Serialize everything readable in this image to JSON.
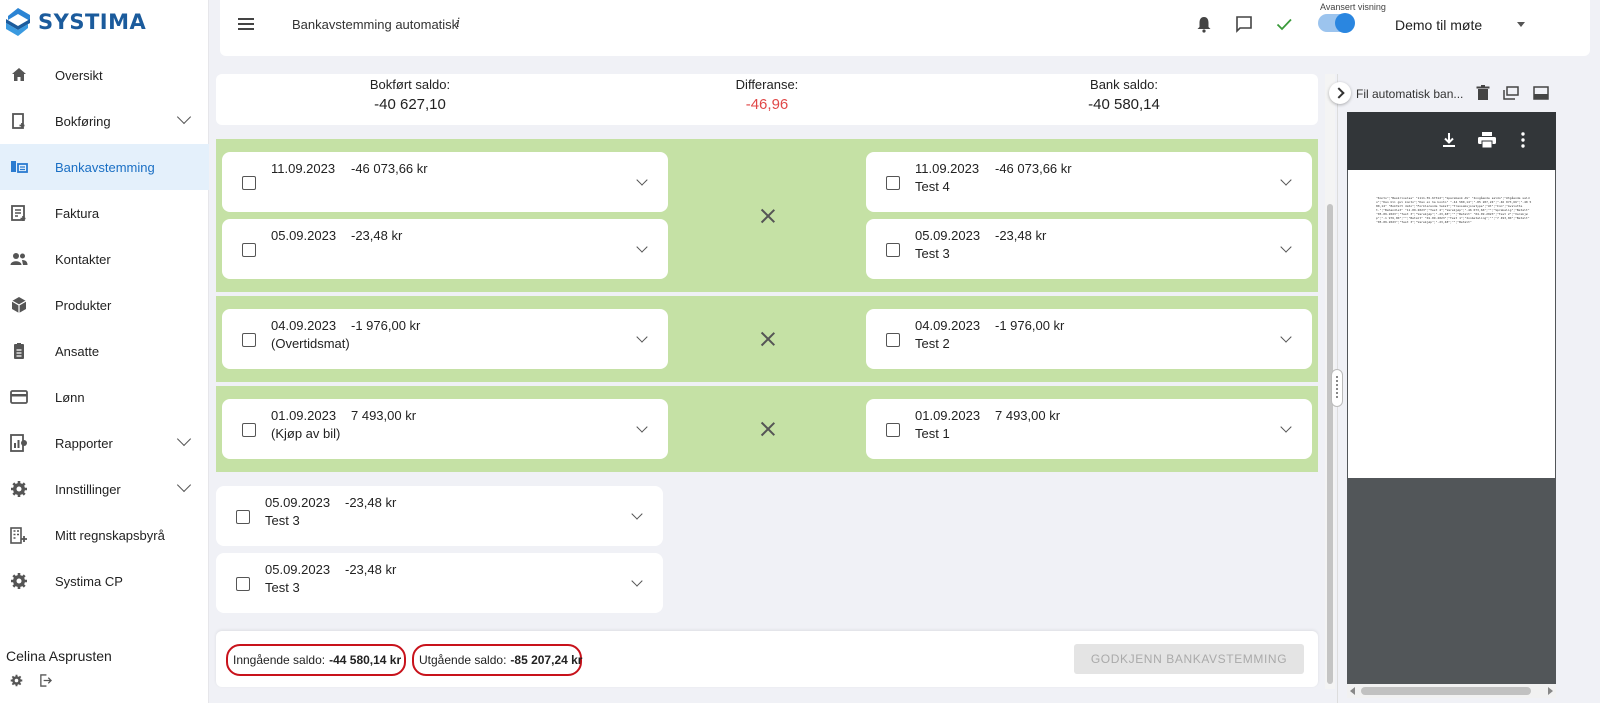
{
  "app": {
    "brand": "SYSTIMA"
  },
  "sidebar": {
    "items": [
      {
        "label": "Oversikt",
        "icon": "home-icon"
      },
      {
        "label": "Bokføring",
        "icon": "bookkeeping-icon"
      },
      {
        "label": "Bankavstemming",
        "icon": "bank-reconciliation-icon"
      },
      {
        "label": "Faktura",
        "icon": "invoice-icon"
      },
      {
        "label": "Kontakter",
        "icon": "contacts-icon"
      },
      {
        "label": "Produkter",
        "icon": "products-icon"
      },
      {
        "label": "Ansatte",
        "icon": "employees-icon"
      },
      {
        "label": "Lønn",
        "icon": "payroll-icon"
      },
      {
        "label": "Rapporter",
        "icon": "reports-icon"
      },
      {
        "label": "Innstillinger",
        "icon": "settings-icon"
      },
      {
        "label": "Mitt regnskapsbyrå",
        "icon": "accounting-firm-icon"
      },
      {
        "label": "Systima CP",
        "icon": "cp-settings-icon"
      }
    ],
    "active_item": "Bankavstemming",
    "user_name": "Celina Asprusten"
  },
  "header": {
    "title": "Bankavstemming automatisk",
    "info_symbol": "i",
    "toggle_label": "Avansert visning",
    "toggle_on": true,
    "organization": "Demo til møte"
  },
  "summary": {
    "booked_label": "Bokført saldo:",
    "booked_value": "-40 627,10",
    "diff_label": "Differanse:",
    "diff_value": "-46,96",
    "bank_label": "Bank saldo:",
    "bank_value": "-40 580,14",
    "diff_color": "#e04848"
  },
  "match_groups": [
    {
      "left": [
        {
          "date": "11.09.2023",
          "amount": "-46 073,66 kr",
          "desc": ""
        },
        {
          "date": "05.09.2023",
          "amount": "-23,48 kr",
          "desc": ""
        }
      ],
      "right": [
        {
          "date": "11.09.2023",
          "amount": "-46 073,66 kr",
          "desc": "Test 4"
        },
        {
          "date": "05.09.2023",
          "amount": "-23,48 kr",
          "desc": "Test 3"
        }
      ]
    },
    {
      "left": [
        {
          "date": "04.09.2023",
          "amount": "-1 976,00 kr",
          "desc": "(Overtidsmat)"
        }
      ],
      "right": [
        {
          "date": "04.09.2023",
          "amount": "-1 976,00 kr",
          "desc": "Test 2"
        }
      ]
    },
    {
      "left": [
        {
          "date": "01.09.2023",
          "amount": "7 493,00 kr",
          "desc": "(Kjøp av bil)"
        }
      ],
      "right": [
        {
          "date": "01.09.2023",
          "amount": "7 493,00 kr",
          "desc": "Test 1"
        }
      ]
    }
  ],
  "unmatched": [
    {
      "date": "05.09.2023",
      "amount": "-23,48 kr",
      "desc": "Test 3"
    },
    {
      "date": "05.09.2023",
      "amount": "-23,48 kr",
      "desc": "Test 3"
    }
  ],
  "footer": {
    "opening_label": "Inngående saldo:",
    "opening_value": "-44 580,14 kr",
    "closing_label": "Utgående saldo:",
    "closing_value": "-85 207,24 kr",
    "approve_label": "GODKJENN BANKAVSTEMMING",
    "highlight_color": "#c8121b"
  },
  "right_panel": {
    "file_name": "Fil automatisk ban...",
    "file_preview": "\"Konto\";\"Beskrivelse\" \"1111.55.67312\";\"Sparebank AS\" \"Inngående saldo\";\"Utgående saldo\";\"Kan bli gul konto\";\"Kan ei ha konto\" \"-44 580,14\";\"-85 207,24\";\"-46 073,66\";\"-40 580,14\" \"Bokført dato\";\"Forklarende tekst\";\"Transaksjonstype\";\"Ut\";\"Inn\";\"Avsluttet.\";\"Behandlet\" \"11.09.2023\";\"Test 4\";\"Varekjøp\";\"-46 073,66\";\"\";\"Sprakelig\";\"Betalt\" \"05.09.2023\";\"Test 3\";\"Varekjøp\";\"-23,48\";\"\";\"Betalt\" \"04.09.2023\";\"Test 2\";\"Varekjøp\";\"-1 976,00\";\"\";\"Betalt\" \"01.09.2023\";\"Test 1\";\"Innbetaling\";\"\";\"7 493,00\";\"Betalt\" \"05.09.2023\";\"Test 3\";\"Varekjøp\";\"-23,48\";\"\";\"Betalt\""
  }
}
